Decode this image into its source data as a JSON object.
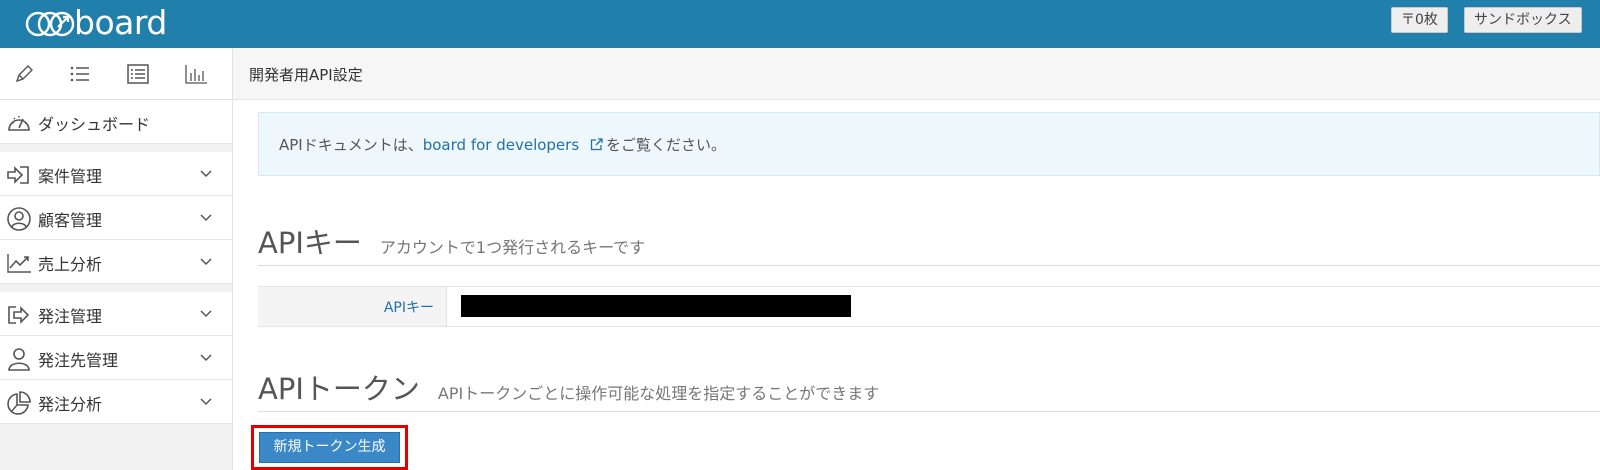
{
  "header": {
    "logo_text": "board",
    "tray_button": "〒0枚",
    "sandbox_button": "サンドボックス",
    "brand_color": "#217fac"
  },
  "sidebar": {
    "tools": [
      {
        "icon": "pencil-icon"
      },
      {
        "icon": "list-icon"
      },
      {
        "icon": "list-box-icon"
      },
      {
        "icon": "bar-chart-icon"
      }
    ],
    "dashboard": {
      "label": "ダッシュボード",
      "icon": "gauge-icon"
    },
    "items": [
      {
        "label": "案件管理",
        "icon": "sign-in-icon"
      },
      {
        "label": "顧客管理",
        "icon": "user-circle-icon"
      },
      {
        "label": "売上分析",
        "icon": "line-chart-icon"
      },
      {
        "label": "発注管理",
        "icon": "share-arrow-icon"
      },
      {
        "label": "発注先管理",
        "icon": "user-icon"
      },
      {
        "label": "発注分析",
        "icon": "pie-chart-icon"
      }
    ]
  },
  "main": {
    "page_title": "開発者用API設定",
    "info": {
      "prefix": "APIドキュメントは、",
      "link": "board for developers",
      "suffix": "をご覧ください。"
    },
    "api_key_section": {
      "title": "APIキー",
      "subtitle": "アカウントで1つ発行されるキーです",
      "label": "APIキー"
    },
    "api_token_section": {
      "title": "APIトークン",
      "subtitle": "APIトークンごとに操作可能な処理を指定することができます",
      "new_button": "新規トークン生成"
    }
  }
}
